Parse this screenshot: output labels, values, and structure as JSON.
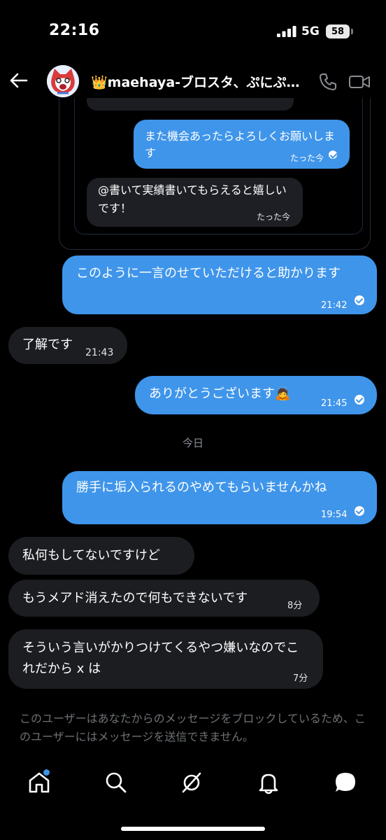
{
  "status_bar": {
    "time": "22:16",
    "network": "5G",
    "battery": "58"
  },
  "header": {
    "crown": "👑",
    "title": "maehaya-ブロスタ、ぷにぷ…"
  },
  "quote": {
    "msg1": {
      "text": "また機会あったらよろしくお願いします",
      "time": "たった今"
    },
    "msg2": {
      "text": "@書いて実績書いてもらえると嬉しいです！",
      "time": "たった今"
    }
  },
  "messages": [
    {
      "text": "このように一言のせていただけると助かります",
      "time": "21:42",
      "dir": "sent"
    },
    {
      "text": "了解です",
      "time": "21:43",
      "dir": "received"
    },
    {
      "text": "ありがとうございます",
      "emoji": "🙇",
      "time": "21:45",
      "dir": "sent"
    },
    {
      "text": "勝手に垢入られるのやめてもらいませんかね",
      "time": "19:54",
      "dir": "sent"
    },
    {
      "text": "私何もしてないですけど",
      "dir": "received"
    },
    {
      "text": "もうメアド消えたので何もできないです",
      "time": "8分",
      "dir": "received"
    },
    {
      "text": "そういう言いがかりつけてくるやつ嫌いなのでこれだから x は",
      "time": "7分",
      "dir": "received"
    }
  ],
  "date_separator": "今日",
  "blocked_notice": "このユーザーはあなたからのメッセージをブロックしているため、このユーザーにはメッセージを送信できません。",
  "nav": {
    "items": [
      "home-icon",
      "search-icon",
      "grok-icon",
      "notifications-icon",
      "messages-icon"
    ]
  },
  "colors": {
    "sent_bubble": "#3f95ea",
    "received_bubble": "#1c1d21",
    "background": "#000000"
  }
}
